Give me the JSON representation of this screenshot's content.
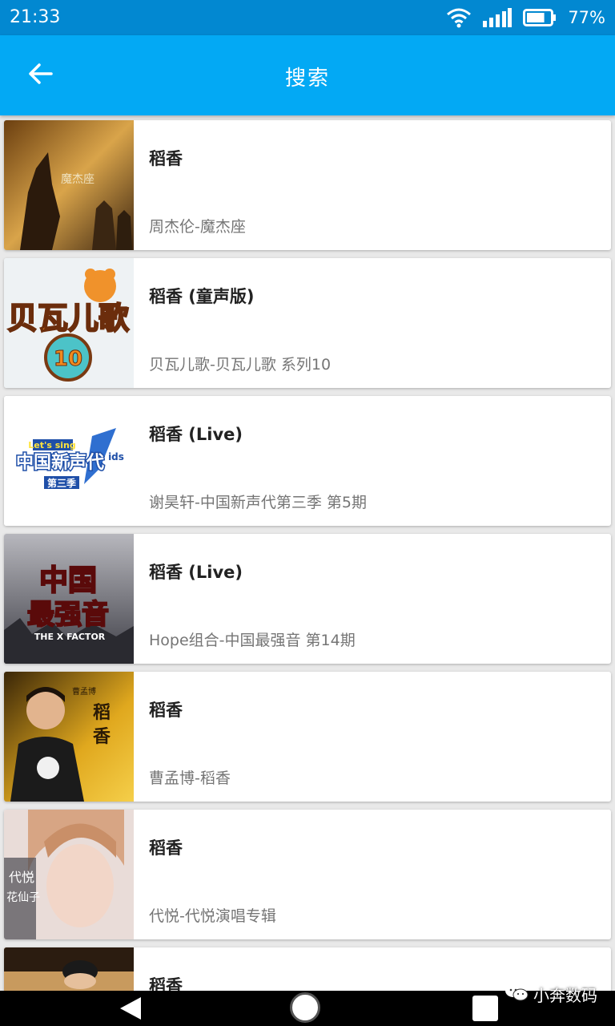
{
  "status_bar": {
    "time": "21:33",
    "battery": "77%",
    "battery_level": 0.77
  },
  "app_bar": {
    "title": "搜索",
    "back_icon": "arrow-left-icon"
  },
  "results": [
    {
      "title": "稻香",
      "subtitle": "周杰伦-魔杰座",
      "cover_text": "魔杰座"
    },
    {
      "title": "稻香 (童声版)",
      "subtitle": "贝瓦儿歌-贝瓦儿歌 系列10",
      "cover_text": "贝瓦儿歌",
      "cover_num": "10"
    },
    {
      "title": "稻香 (Live)",
      "subtitle": "谢昊轩-中国新声代第三季 第5期",
      "cover_text": "中国新声代",
      "cover_top": "Let's sing",
      "cover_sub": "第三季",
      "cover_side": "ids"
    },
    {
      "title": "稻香 (Live)",
      "subtitle": "Hope组合-中国最强音 第14期",
      "cover_text": "中国",
      "cover_line2": "最强音",
      "cover_tag": "THE X FACTOR"
    },
    {
      "title": "稻香",
      "subtitle": "曹孟博-稻香",
      "cover_text": "稻",
      "cover_text2": "香",
      "cover_small": "曹孟博"
    },
    {
      "title": "稻香",
      "subtitle": "代悦-代悦演唱专辑",
      "cover_text": "代悦",
      "cover_text2": "花仙子"
    },
    {
      "title": "稻香",
      "subtitle": ""
    }
  ],
  "navigation": {
    "back_icon": "nav-back-icon",
    "home_icon": "nav-home-icon",
    "recent_icon": "nav-recent-icon"
  },
  "watermark": {
    "text": "小奔数码",
    "icon": "wechat-icon"
  },
  "colors": {
    "status_bar": "#0288d1",
    "app_bar": "#03a9f4",
    "card": "#ffffff",
    "background": "#e9e9e9"
  }
}
